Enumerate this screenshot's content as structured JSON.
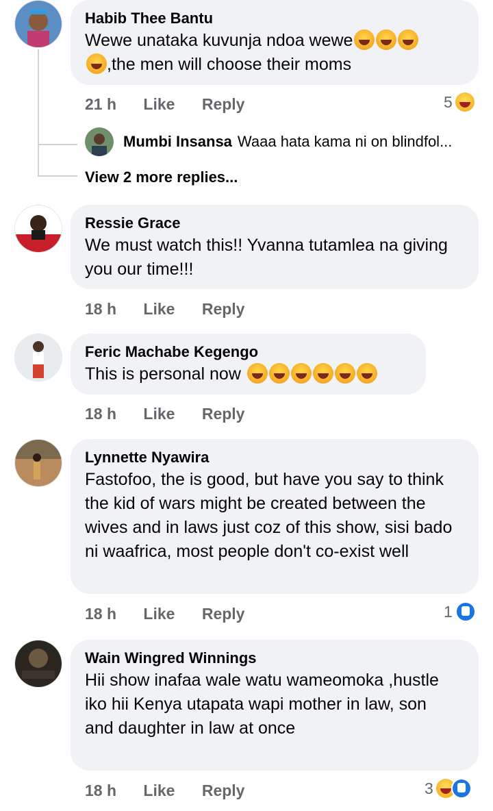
{
  "comments": [
    {
      "author": "Habib Thee Bantu",
      "text_line1": "Wewe unataka kuvunja ndoa wewe",
      "text_line2": ",the men will choose their moms",
      "time": "21 h",
      "like": "Like",
      "reply": "Reply",
      "reaction_count": "5",
      "reaction_icons": [
        "haha-icon"
      ],
      "replies": {
        "preview_author": "Mumbi Insansa",
        "preview_text": "Waaa hata kama ni on blindfol...",
        "view_more": "View 2 more replies..."
      }
    },
    {
      "author": "Ressie Grace",
      "text": "We must watch this!! Yvanna tutamlea na giving you our time!!!",
      "time": "18 h",
      "like": "Like",
      "reply": "Reply"
    },
    {
      "author": "Feric Machabe Kegengo",
      "text": "This is personal now",
      "time": "18 h",
      "like": "Like",
      "reply": "Reply"
    },
    {
      "author": "Lynnette Nyawira",
      "text": "Fastofoo, the is good, but have you say to think the kid of wars might be created between the wives and in laws just coz of this show, sisi bado ni waafrica, most people don't co-exist well",
      "time": "18 h",
      "like": "Like",
      "reply": "Reply",
      "reaction_count": "1",
      "reaction_icons": [
        "like-icon"
      ]
    },
    {
      "author": "Wain Wingred Winnings",
      "text": "Hii show inafaa wale watu wameomoka ,hustle iko hii Kenya utapata wapi mother in law, son and daughter in law at once",
      "time": "18 h",
      "like": "Like",
      "reply": "Reply",
      "reaction_count": "3",
      "reaction_icons": [
        "haha-icon",
        "like-icon"
      ]
    }
  ]
}
